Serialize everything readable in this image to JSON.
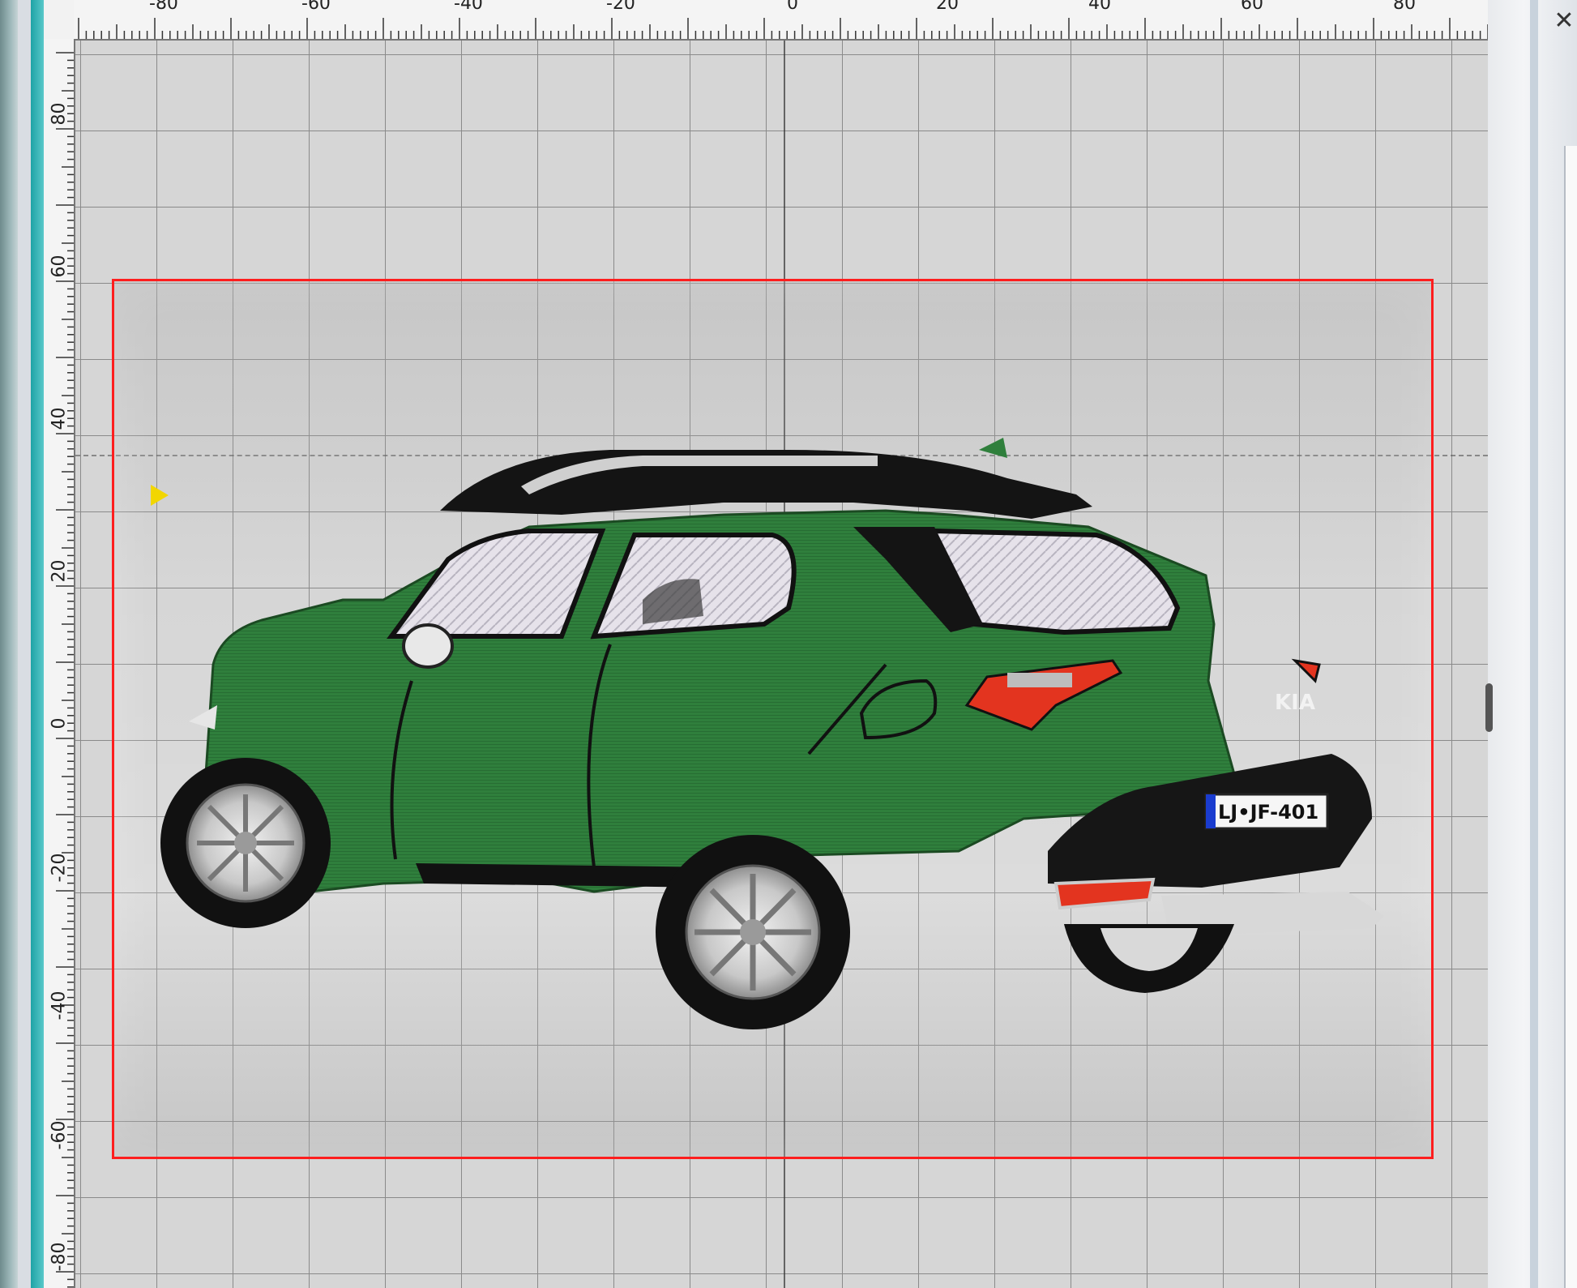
{
  "ruler": {
    "unit": "mm",
    "top_labels": [
      "-80",
      "-60",
      "-40",
      "-20",
      "0",
      "20",
      "40",
      "60",
      "80"
    ],
    "left_labels": [
      "80",
      "60",
      "40",
      "20",
      "0",
      "-20",
      "-40",
      "-60",
      "-80"
    ]
  },
  "design": {
    "license_plate": "LJ•JF-401",
    "badge": "KIA"
  },
  "colors": {
    "hoop_border": "#ff1e1e",
    "body_green": "#2e7d3a",
    "grid_line": "#8a8a8a",
    "canvas_bg": "#d6d6d6",
    "marker": "#f2d600"
  },
  "icons": {
    "close": "✕"
  }
}
